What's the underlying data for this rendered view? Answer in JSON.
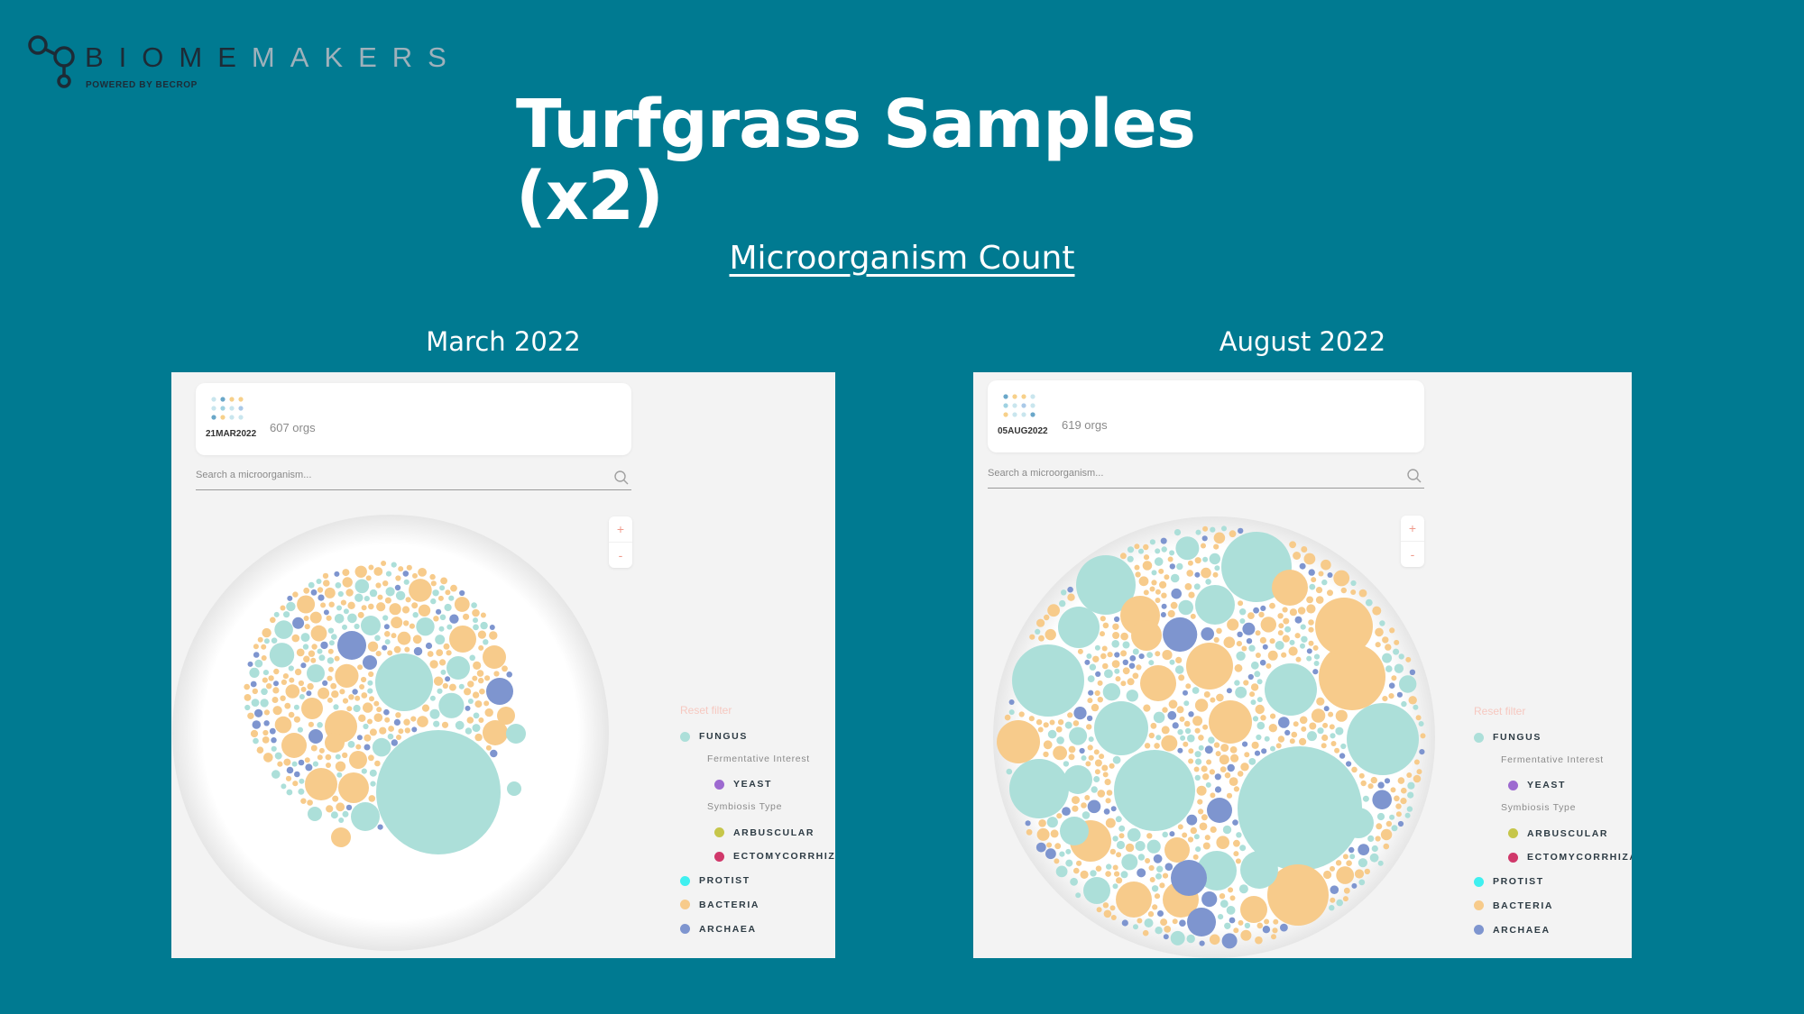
{
  "brand": {
    "name_part1": "BIOME",
    "name_part2": "MAKERS",
    "tagline": "POWERED BY BECROP"
  },
  "title": "Turfgrass Samples (x2)",
  "subtitle": "Microorganism Count",
  "colors": {
    "background": "#007a91",
    "fungus": "#acdfd9",
    "yeast": "#9d6ad0",
    "arbuscular": "#c6c64a",
    "ectomycorrhiza": "#d0386a",
    "protist": "#3ff0f0",
    "bacteria": "#f7cb8b",
    "archaea": "#7e95cf",
    "reset_filter": "#f6c8c0"
  },
  "panels": [
    {
      "label": "March 2022",
      "date_badge": "21MAR2022",
      "org_count": "607 orgs",
      "search_placeholder": "Search a microorganism...",
      "zoom_in": "+",
      "zoom_out": "-"
    },
    {
      "label": "August 2022",
      "date_badge": "05AUG2022",
      "org_count": "619 orgs",
      "search_placeholder": "Search a microorganism...",
      "zoom_in": "+",
      "zoom_out": "-"
    }
  ],
  "legend": {
    "reset_filter": "Reset filter",
    "items": [
      {
        "label": "FUNGUS",
        "kind": "item",
        "color_key": "fungus"
      },
      {
        "label": "Fermentative Interest",
        "kind": "group"
      },
      {
        "label": "YEAST",
        "kind": "sub",
        "color_key": "yeast"
      },
      {
        "label": "Symbiosis Type",
        "kind": "group"
      },
      {
        "label": "ARBUSCULAR",
        "kind": "sub",
        "color_key": "arbuscular"
      },
      {
        "label": "ECTOMYCORRHIZA",
        "kind": "sub",
        "color_key": "ectomycorrhiza"
      },
      {
        "label": "PROTIST",
        "kind": "item",
        "color_key": "protist"
      },
      {
        "label": "BACTERIA",
        "kind": "item",
        "color_key": "bacteria"
      },
      {
        "label": "ARCHAEA",
        "kind": "item",
        "color_key": "archaea"
      }
    ]
  }
}
